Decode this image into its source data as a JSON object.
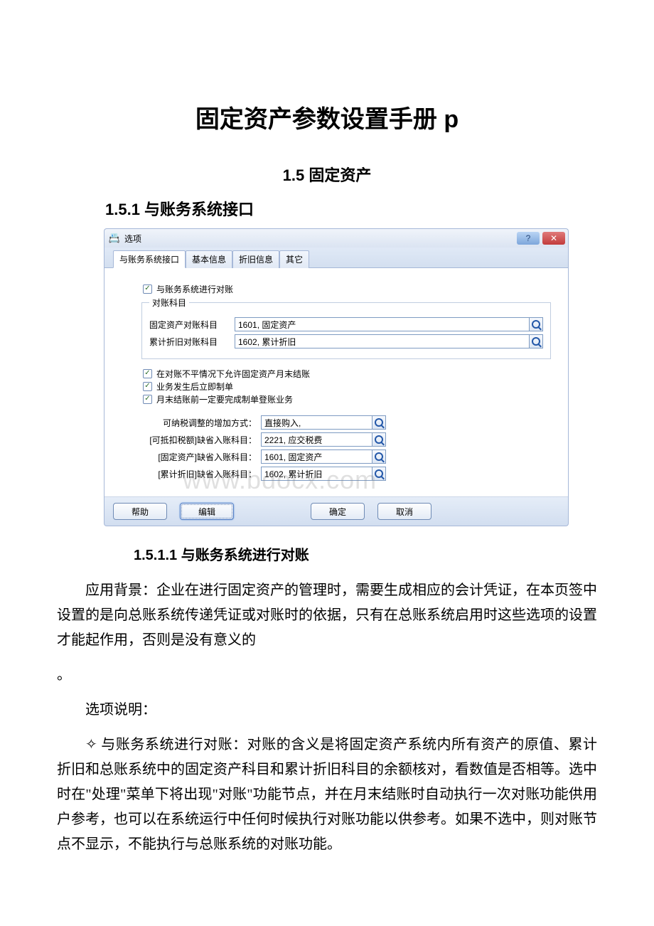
{
  "doc": {
    "title": "固定资产参数设置手册 p",
    "h2": "1.5 固定资产",
    "h3": "1.5.1 与账务系统接口",
    "h4": "1.5.1.1 与账务系统进行对账",
    "para1": "应用背景：企业在进行固定资产的管理时，需要生成相应的会计凭证，在本页签中设置的是向总账系统传递凭证或对账时的依据，只有在总账系统启用时这些选项的设置才能起作用，否则是没有意义的",
    "para1_tail": "。",
    "para2": "选项说明：",
    "para3": "✧ 与账务系统进行对账：对账的含义是将固定资产系统内所有资产的原值、累计折旧和总账系统中的固定资产科目和累计折旧科目的余额核对，看数值是否相等。选中时在\"处理\"菜单下将出现\"对账\"功能节点，并在月末结账时自动执行一次对账功能供用户参考，也可以在系统运行中任何时候执行对账功能以供参考。如果不选中，则对账节点不显示，不能执行与总账系统的对账功能。"
  },
  "dialog": {
    "title": "选项",
    "icon_glyph": "📇",
    "help_glyph": "?",
    "close_glyph": "✕",
    "tabs": [
      "与账务系统接口",
      "基本信息",
      "折旧信息",
      "其它"
    ],
    "chk_reconcile": "与账务系统进行对账",
    "legend": "对账科目",
    "row_fixed_label": "固定资产对账科目",
    "row_fixed_value": "1601, 固定资产",
    "row_dep_label": "累计折旧对账科目",
    "row_dep_value": "1602, 累计折旧",
    "chk_allow": "在对账不平情况下允许固定资产月末结账",
    "chk_immediate": "业务发生后立即制单",
    "chk_monthend": "月末结账前一定要完成制单登账业务",
    "r1_label": "可纳税调整的增加方式：",
    "r1_value": "直接购入,",
    "r2_label": "[可抵扣税额]缺省入账科目：",
    "r2_value": "2221, 应交税费",
    "r3_label": "[固定资产]缺省入账科目：",
    "r3_value": "1601, 固定资产",
    "r4_label": "[累计折旧]缺省入账科目：",
    "r4_value": "1602, 累计折旧",
    "btn_help": "帮助",
    "btn_edit": "编辑",
    "btn_ok": "确定",
    "btn_cancel": "取消"
  },
  "watermark": "www.bdocx.com"
}
